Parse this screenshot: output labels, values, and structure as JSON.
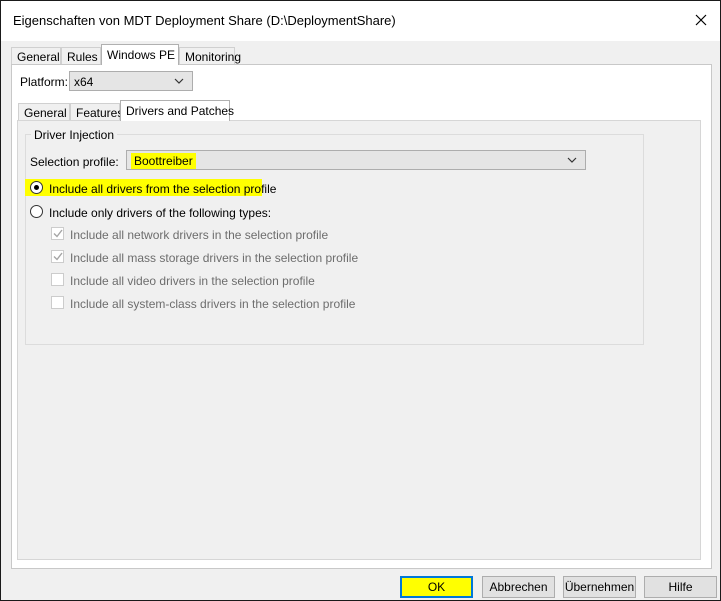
{
  "window": {
    "title": "Eigenschaften von MDT Deployment Share (D:\\DeploymentShare)"
  },
  "main_tabs": [
    {
      "label": "General"
    },
    {
      "label": "Rules"
    },
    {
      "label": "Windows PE"
    },
    {
      "label": "Monitoring"
    }
  ],
  "platform": {
    "label": "Platform:",
    "value": "x64"
  },
  "sub_tabs": [
    {
      "label": "General"
    },
    {
      "label": "Features"
    },
    {
      "label": "Drivers and Patches"
    }
  ],
  "driver_injection": {
    "group_label": "Driver Injection",
    "selection_profile_label": "Selection profile:",
    "selection_profile_value": "Boottreiber",
    "radio_all": "Include all drivers from the selection profile",
    "radio_only": "Include only drivers of the following types:",
    "checkboxes": [
      {
        "label": "Include all network drivers in the selection profile",
        "checked": true
      },
      {
        "label": "Include all mass storage drivers in the selection profile",
        "checked": true
      },
      {
        "label": "Include all video drivers in the selection profile",
        "checked": false
      },
      {
        "label": "Include all system-class drivers in the selection profile",
        "checked": false
      }
    ]
  },
  "buttons": {
    "ok": "OK",
    "cancel": "Abbrechen",
    "apply": "Übernehmen",
    "help": "Hilfe"
  },
  "colors": {
    "highlight": "#ffff00",
    "focus_border": "#0078d7"
  }
}
